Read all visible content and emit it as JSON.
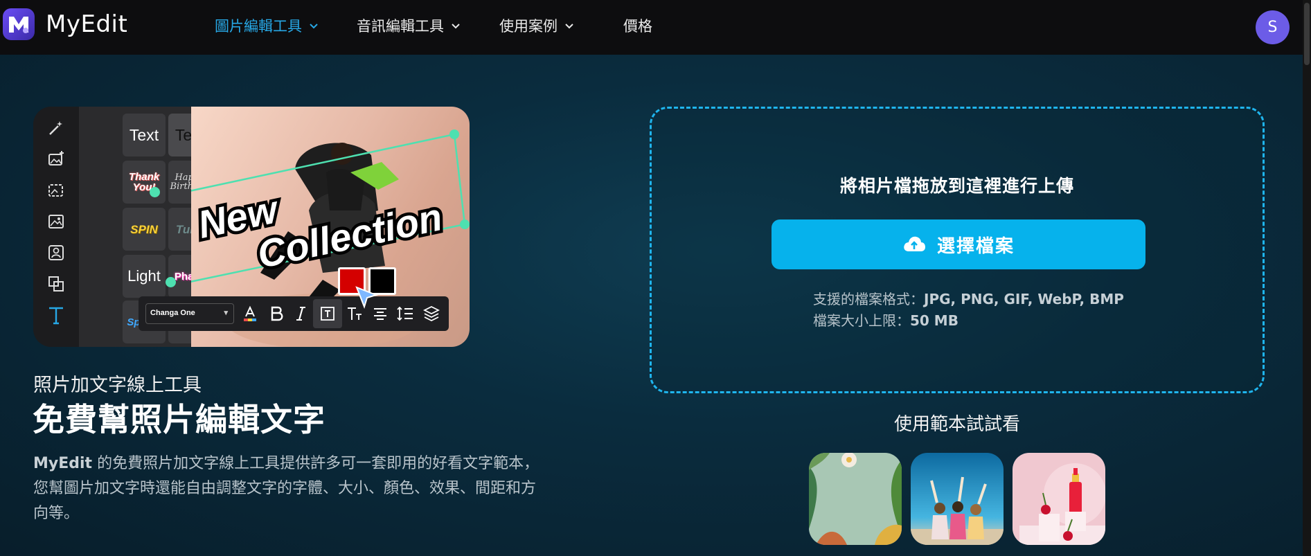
{
  "app": {
    "name": "MyEdit",
    "avatar_letter": "S"
  },
  "nav": {
    "items": [
      {
        "label": "圖片編輯工具",
        "has_dropdown": true,
        "active": true
      },
      {
        "label": "音訊編輯工具",
        "has_dropdown": true,
        "active": false
      },
      {
        "label": "使用案例",
        "has_dropdown": true,
        "active": false
      },
      {
        "label": "價格",
        "has_dropdown": false,
        "active": false
      }
    ]
  },
  "hero": {
    "tiles": [
      "Text",
      "Text",
      "Thank You!",
      "Happy Birthday",
      "SPIN",
      "Tune",
      "Light",
      "Phase",
      "Splash"
    ],
    "overlay_text_1": "New",
    "overlay_text_2": "Collection",
    "font_select": "Changa One",
    "swatch_colors": [
      "#d40000",
      "#000000"
    ]
  },
  "intro": {
    "subtitle": "照片加文字線上工具",
    "title": "免費幫照片編輯文字",
    "desc_brand": "MyEdit",
    "desc_line1": " 的免費照片加文字線上工具提供許多可一套即用的好看文字範本，",
    "desc_line2": "您幫圖片加文字時還能自由調整文字的字體、大小、顏色、效果、間距和方",
    "desc_line3": "向等。"
  },
  "upload": {
    "drop_text": "將相片檔拖放到這裡進行上傳",
    "button_label": "選擇檔案",
    "formats_label": "支援的檔案格式：",
    "formats_value": "JPG, PNG, GIF, WebP, BMP",
    "size_label": "檔案大小上限：",
    "size_value": "50 MB"
  },
  "templates": {
    "title": "使用範本試試看"
  },
  "colors": {
    "accent": "#27a8e6",
    "button": "#06b2ec",
    "dashed_border": "#1fb5ee",
    "avatar": "#6c5ce7"
  }
}
